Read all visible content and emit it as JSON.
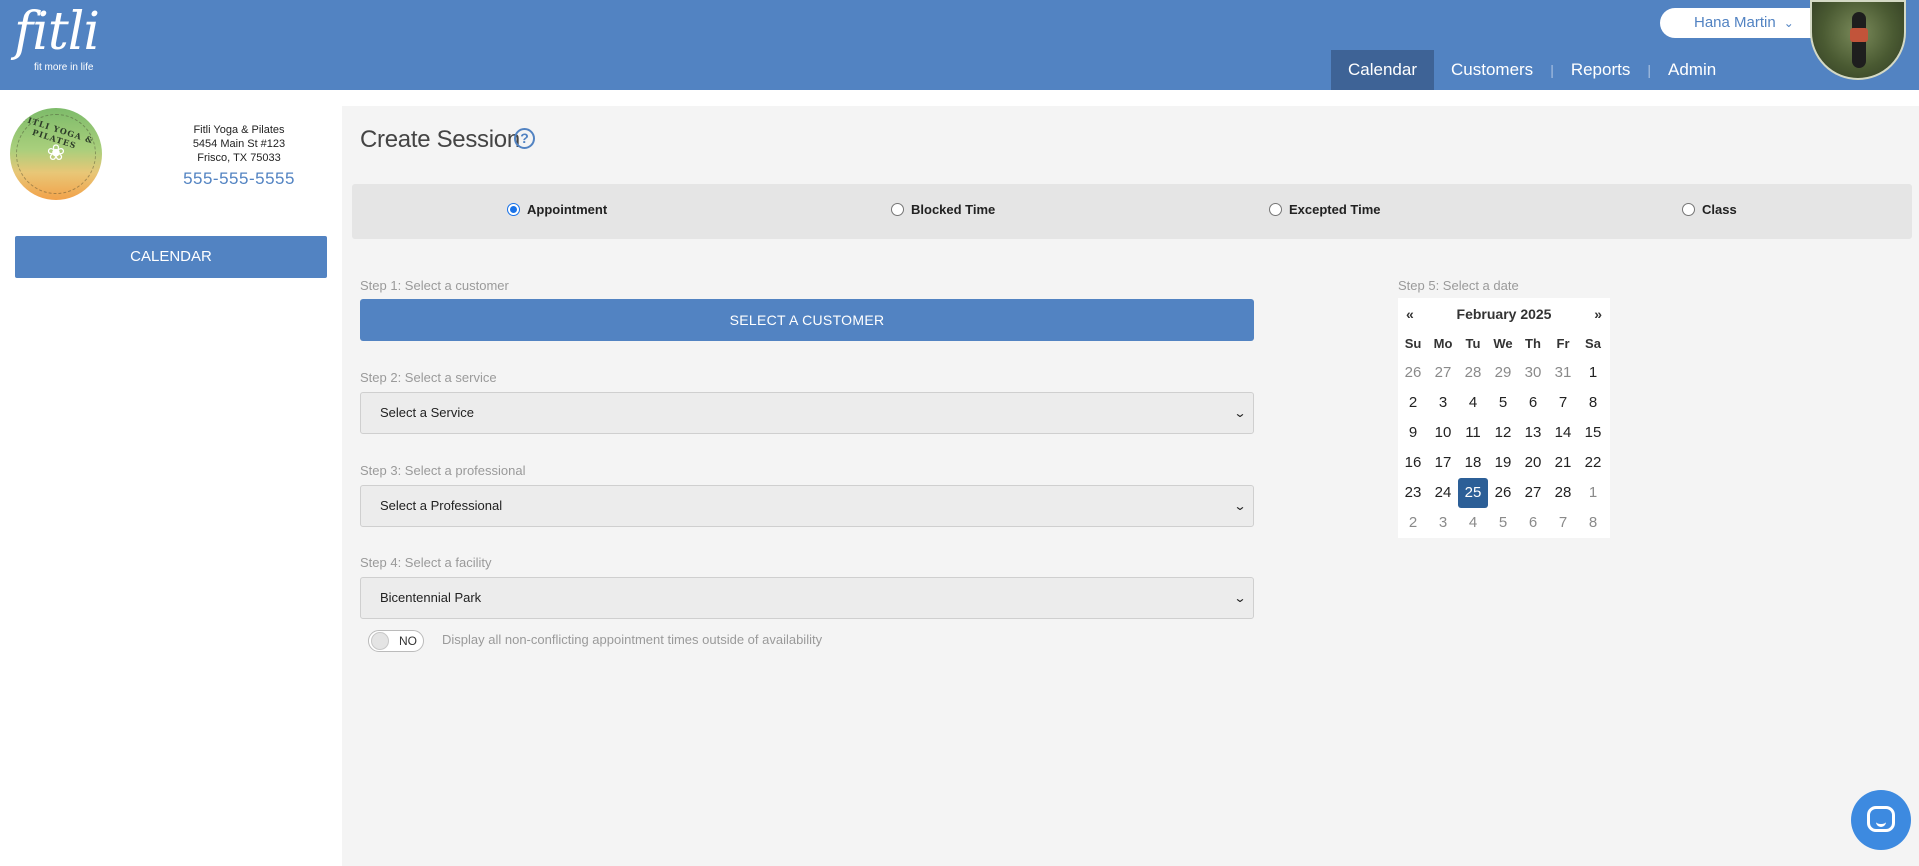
{
  "brand": {
    "name": "fitli",
    "tagline": "fit more in life"
  },
  "user": {
    "name": "Hana Martin",
    "menu_icon": "chevron-down-icon"
  },
  "nav": [
    {
      "label": "Calendar",
      "active": true
    },
    {
      "label": "Customers",
      "active": false
    },
    {
      "label": "Reports",
      "active": false
    },
    {
      "label": "Admin",
      "active": false
    }
  ],
  "business": {
    "name": "Fitli Yoga & Pilates",
    "address1": "5454 Main St #123",
    "address2": "Frisco, TX 75033",
    "phone": "555-555-5555",
    "logo_text": "FITLI YOGA & PILATES"
  },
  "sidebar": {
    "calendar_button": "CALENDAR"
  },
  "page": {
    "title": "Create Session",
    "help_icon": "question-circle-icon"
  },
  "session_types": [
    {
      "label": "Appointment",
      "checked": true
    },
    {
      "label": "Blocked Time",
      "checked": false
    },
    {
      "label": "Excepted Time",
      "checked": false
    },
    {
      "label": "Class",
      "checked": false
    }
  ],
  "steps": {
    "step1": {
      "label": "Step 1: Select a customer",
      "button": "SELECT A CUSTOMER"
    },
    "step2": {
      "label": "Step 2: Select a service",
      "value": "Select a Service"
    },
    "step3": {
      "label": "Step 3: Select a professional",
      "value": "Select a Professional"
    },
    "step4": {
      "label": "Step 4: Select a facility",
      "value": "Bicentennial Park"
    },
    "step5": {
      "label": "Step 5: Select a date"
    }
  },
  "toggle": {
    "state": "NO",
    "label": "Display all non-conflicting appointment times outside of availability"
  },
  "calendar": {
    "prev": "«",
    "next": "»",
    "title": "February 2025",
    "days_of_week": [
      "Su",
      "Mo",
      "Tu",
      "We",
      "Th",
      "Fr",
      "Sa"
    ],
    "weeks": [
      [
        {
          "d": "26",
          "m": true
        },
        {
          "d": "27",
          "m": true
        },
        {
          "d": "28",
          "m": true
        },
        {
          "d": "29",
          "m": true
        },
        {
          "d": "30",
          "m": true
        },
        {
          "d": "31",
          "m": true
        },
        {
          "d": "1",
          "m": false
        }
      ],
      [
        {
          "d": "2",
          "m": false
        },
        {
          "d": "3",
          "m": false
        },
        {
          "d": "4",
          "m": false
        },
        {
          "d": "5",
          "m": false
        },
        {
          "d": "6",
          "m": false
        },
        {
          "d": "7",
          "m": false
        },
        {
          "d": "8",
          "m": false
        }
      ],
      [
        {
          "d": "9",
          "m": false
        },
        {
          "d": "10",
          "m": false
        },
        {
          "d": "11",
          "m": false
        },
        {
          "d": "12",
          "m": false
        },
        {
          "d": "13",
          "m": false
        },
        {
          "d": "14",
          "m": false
        },
        {
          "d": "15",
          "m": false
        }
      ],
      [
        {
          "d": "16",
          "m": false
        },
        {
          "d": "17",
          "m": false
        },
        {
          "d": "18",
          "m": false
        },
        {
          "d": "19",
          "m": false
        },
        {
          "d": "20",
          "m": false
        },
        {
          "d": "21",
          "m": false
        },
        {
          "d": "22",
          "m": false
        }
      ],
      [
        {
          "d": "23",
          "m": false
        },
        {
          "d": "24",
          "m": false
        },
        {
          "d": "25",
          "m": false,
          "selected": true
        },
        {
          "d": "26",
          "m": false
        },
        {
          "d": "27",
          "m": false
        },
        {
          "d": "28",
          "m": false
        },
        {
          "d": "1",
          "m": true
        }
      ],
      [
        {
          "d": "2",
          "m": true
        },
        {
          "d": "3",
          "m": true
        },
        {
          "d": "4",
          "m": true
        },
        {
          "d": "5",
          "m": true
        },
        {
          "d": "6",
          "m": true
        },
        {
          "d": "7",
          "m": true
        },
        {
          "d": "8",
          "m": true
        }
      ]
    ]
  },
  "colors": {
    "primary": "#5283c2",
    "nav_active": "#3e6396",
    "selected_day": "#2c5f97",
    "chat": "#3d8ae0"
  },
  "chat": {
    "icon": "chat-bubble-icon"
  }
}
